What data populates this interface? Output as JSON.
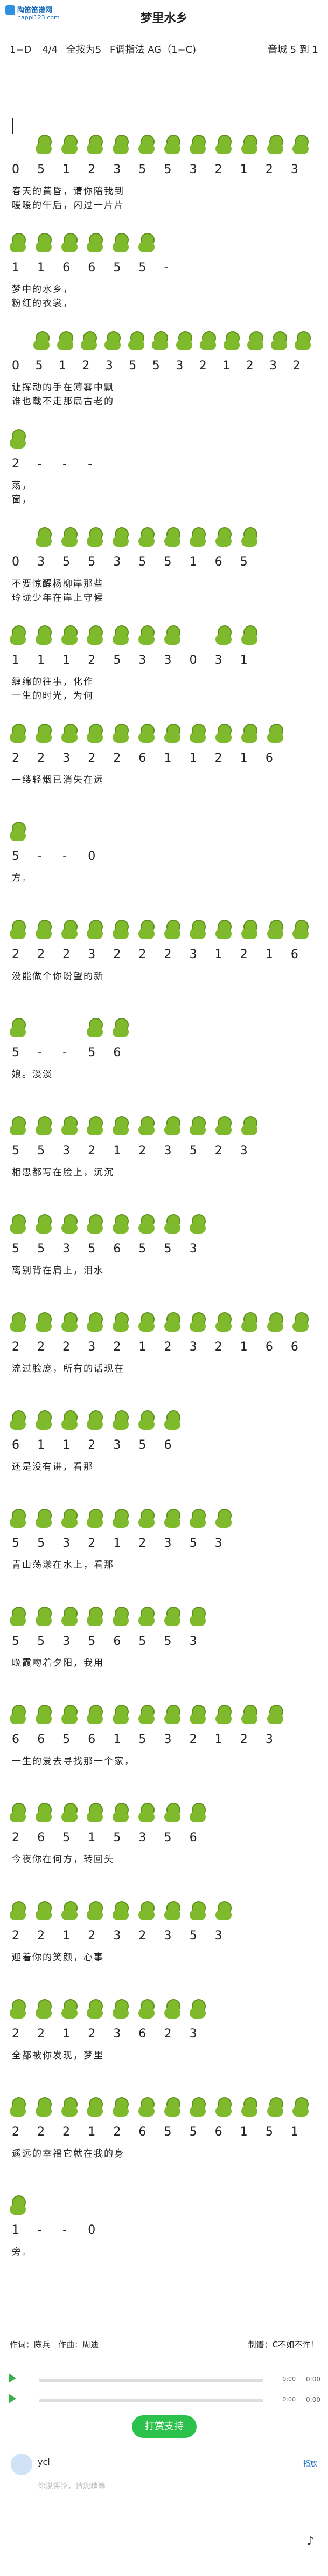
{
  "site": {
    "name": "陶笛笛谱网",
    "url": "happi123.com"
  },
  "title": "梦里水乡",
  "meta": {
    "key": "1=D",
    "time_top": "4",
    "time_bottom": "4",
    "note1": "全按为",
    "note1_num": "5",
    "mode": "F调指法 AG（1=C)",
    "right": "音城",
    "right_num": "5",
    "right_suffix": "到",
    "right_num2": "1"
  },
  "rows": [
    {
      "notes": "0 5 1 2 3 5 5 3 2 1 2 3",
      "lyric1": "春天的黄昏，请你陪我到",
      "lyric2": "暖暖的午后，闪过一片片"
    },
    {
      "notes": "1 1 6 6 5 5 -",
      "lyric1": "梦中的水乡，",
      "lyric2": "粉红的衣裳，"
    },
    {
      "notes": "0 5 1 2 3 5 5 3 2 1 2 3 2",
      "lyric1": "让挥动的手在薄雾中飘",
      "lyric2": "谁也载不走那扇古老的"
    },
    {
      "notes": "2 - - -",
      "lyric1": "荡，",
      "lyric2": "窗，"
    },
    {
      "notes": "0 3 5 5 3 5 5 1 6 5",
      "lyric1": "不要惊醒杨柳岸那些",
      "lyric2": "玲珑少年在岸上守候"
    },
    {
      "notes": "1 1 1 2 5 3 3 0 3 1",
      "lyric1": "缠绵的往事，化作",
      "lyric2": "一生的时光，为何"
    },
    {
      "notes": "2 2 3 2 2 6 1 1 2 1 6",
      "lyric1": "一缕轻烟已消失在远",
      "lyric2": ""
    },
    {
      "notes": "5 - - 0",
      "lyric1": "方。",
      "lyric2": ""
    },
    {
      "notes": "2 2 2 3 2 2 2 3 1 2 1 6",
      "lyric1": "没能做个你盼望的新",
      "lyric2": ""
    },
    {
      "notes": "5 - - 5 6",
      "lyric1": "娘。淡淡",
      "lyric2": ""
    },
    {
      "notes": "5 5 3 2 1 2 3 5 2 3",
      "lyric1": "相思都写在脸上，沉沉",
      "lyric2": ""
    },
    {
      "notes": "5 5 3 5 6 5 5 3",
      "lyric1": "离别背在肩上，泪水",
      "lyric2": ""
    },
    {
      "notes": "2 2 2 3 2 1 2 3 2 1 6 6",
      "lyric1": "流过脸庞，所有的话现在",
      "lyric2": ""
    },
    {
      "notes": "6 1 1 2 3 5 6",
      "lyric1": "还是没有讲，看那",
      "lyric2": ""
    },
    {
      "notes": "5 5 3 2 1 2 3 5 3",
      "lyric1": "青山荡漾在水上，看那",
      "lyric2": ""
    },
    {
      "notes": "5 5 3 5 6 5 5 3",
      "lyric1": "晚霞吻着夕阳，我用",
      "lyric2": ""
    },
    {
      "notes": "6 6 5 6 1 5 3 2 1 2 3",
      "lyric1": "一生的爱去寻找那一个家，",
      "lyric2": ""
    },
    {
      "notes": "2 6 5 1 5 3 5 6",
      "lyric1": "今夜你在何方，转回头",
      "lyric2": ""
    },
    {
      "notes": "2 2 1 2 3 2 3 5 3",
      "lyric1": "迎着你的笑颜，心事",
      "lyric2": ""
    },
    {
      "notes": "2 2 1 2 3 6 2 3",
      "lyric1": "全都被你发现，梦里",
      "lyric2": ""
    },
    {
      "notes": "2 2 2 1 2 6 5 5 6 1 5 1",
      "lyric1": "遥远的幸福它就在我的身",
      "lyric2": ""
    },
    {
      "notes": "1 - - 0",
      "lyric1": "旁。",
      "lyric2": ""
    }
  ],
  "footer": {
    "credits": "作词：陈兵　作曲：周迪",
    "author": "制谱：C不如不许！"
  },
  "player": [
    {
      "time": "0:00",
      "vol": "0:00"
    },
    {
      "time": "0:00",
      "vol": "0:00"
    }
  ],
  "support_label": "打赏支持",
  "comment": {
    "user": "ycl",
    "reply": "播放",
    "placeholder": "你说评论，请您稍等",
    "icon": "music-note-icon"
  }
}
